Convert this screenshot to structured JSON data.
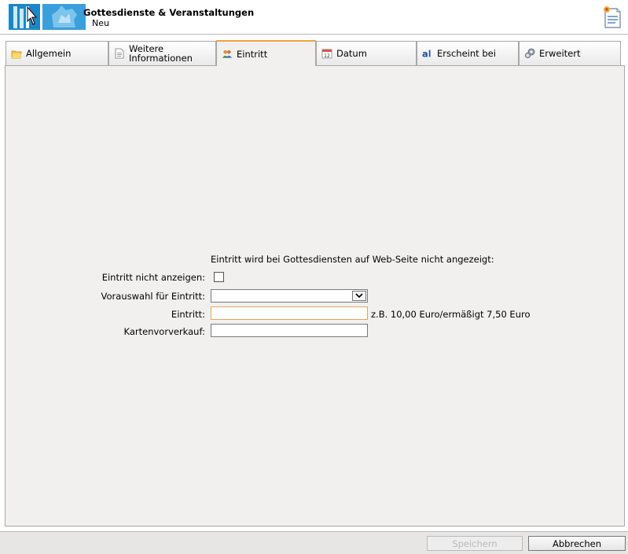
{
  "header": {
    "title": "Gottesdienste & Veranstaltungen",
    "subtitle": "Neu"
  },
  "tabs": [
    {
      "label": "Allgemein",
      "icon": "folder-icon"
    },
    {
      "label": "Weitere Informationen",
      "icon": "document-icon"
    },
    {
      "label": "Eintritt",
      "icon": "people-icon",
      "active": true
    },
    {
      "label": "Datum",
      "icon": "calendar-icon"
    },
    {
      "label": "Erscheint bei",
      "icon": "text-a-icon"
    },
    {
      "label": "Erweitert",
      "icon": "gears-icon"
    }
  ],
  "form": {
    "note": "Eintritt wird bei Gottesdiensten auf Web-Seite nicht angezeigt:",
    "hide_label": "Eintritt nicht anzeigen:",
    "hide_checked": false,
    "preselect_label": "Vorauswahl für Eintritt:",
    "preselect_value": "",
    "entry_label": "Eintritt:",
    "entry_value": "",
    "entry_hint": "z.B. 10,00 Euro/ermäßigt 7,50 Euro",
    "presale_label": "Kartenvorverkauf:",
    "presale_value": ""
  },
  "footer": {
    "save_label": "Speichern",
    "save_disabled": true,
    "cancel_label": "Abbrechen"
  },
  "colors": {
    "active_tab_accent": "#f0a43c",
    "content_bg": "#f1f0ee",
    "logo_blue": "#1d86c8"
  }
}
